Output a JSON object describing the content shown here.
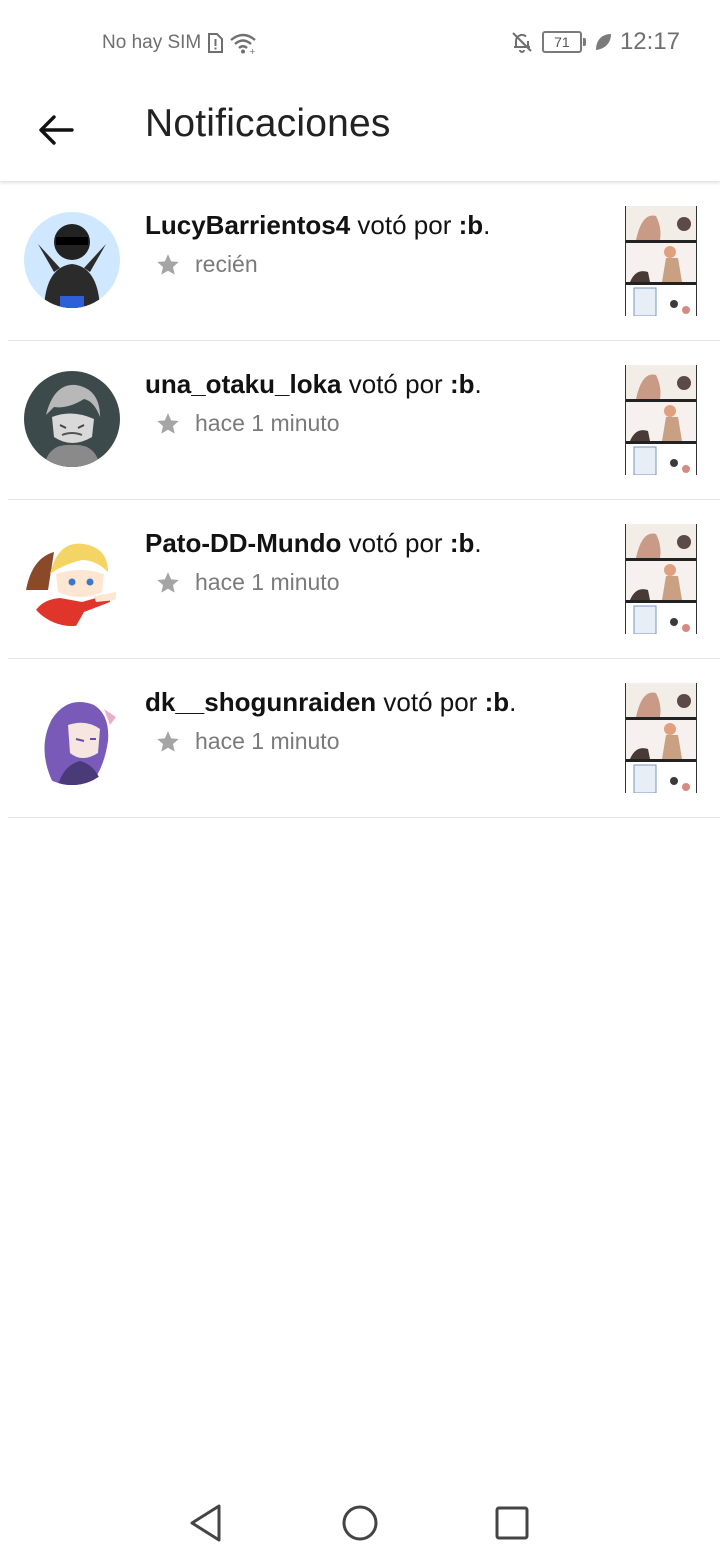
{
  "status_bar": {
    "carrier": "No hay SIM",
    "battery": "71",
    "time": "12:17",
    "icons": [
      "sim-alert-icon",
      "wifi-icon",
      "bell-off-icon",
      "battery-icon",
      "leaf-icon"
    ]
  },
  "app_bar": {
    "back_icon": "arrow-left-icon",
    "title": "Notificaciones"
  },
  "notifications": [
    {
      "user": "LucyBarrientos4",
      "action": "votó por",
      "story": ":b",
      "time": "recién"
    },
    {
      "user": "una_otaku_loka",
      "action": "votó por",
      "story": ":b",
      "time": "hace 1 minuto"
    },
    {
      "user": "Pato-DD-Mundo",
      "action": "votó por",
      "story": ":b",
      "time": "hace 1 minuto"
    },
    {
      "user": "dk__shogunraiden",
      "action": "votó por",
      "story": ":b",
      "time": "hace 1 minuto"
    }
  ],
  "nav_bar": {
    "icons": [
      "back-triangle-icon",
      "home-circle-icon",
      "recents-square-icon"
    ]
  }
}
